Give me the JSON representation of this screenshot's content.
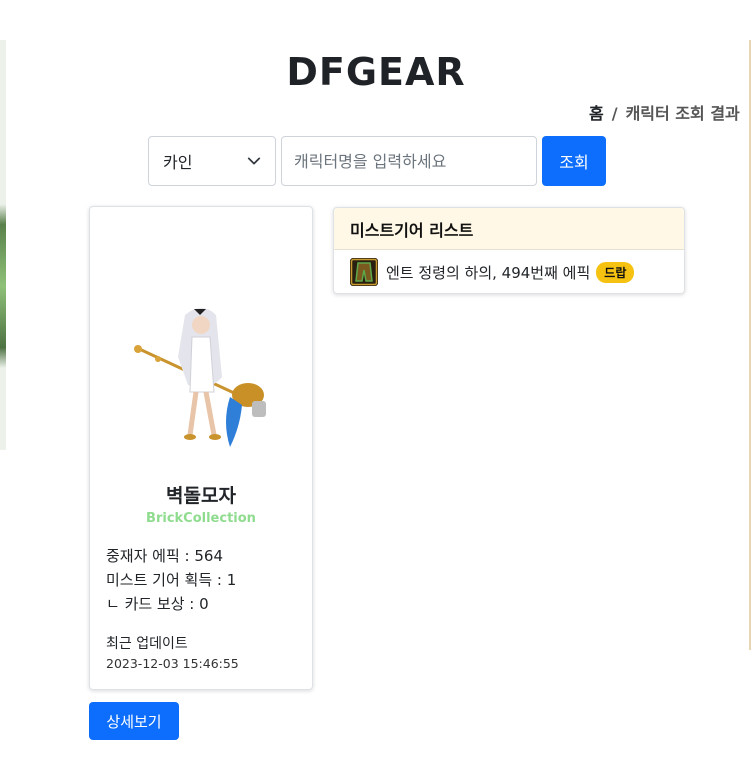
{
  "site": {
    "logo": "DFGEAR"
  },
  "breadcrumb": {
    "home": "홈",
    "separator": "/",
    "current": "캐릭터 조회 결과"
  },
  "search": {
    "server_selected": "카인",
    "placeholder": "캐릭터명을 입력하세요",
    "button_label": "조회"
  },
  "character": {
    "name": "벽돌모자",
    "guild": "BrickCollection",
    "stats": [
      "중재자 에픽 : 564",
      "미스트 기어 획득 : 1",
      "ㄴ 카드 보상 : 0"
    ],
    "updated_label": "최근 업데이트",
    "updated_time": "2023-12-03 15:46:55",
    "detail_button": "상세보기"
  },
  "mist_list": {
    "title": "미스트기어 리스트",
    "items": [
      {
        "name": "엔트 정령의 하의, 494번째 에픽",
        "badge": "드랍",
        "icon": "item-pants-icon"
      }
    ]
  },
  "colors": {
    "primary": "#0d6efd",
    "guild_text": "#8fdc8f",
    "list_header_bg": "#fff8e6",
    "badge": "#f5c211"
  }
}
